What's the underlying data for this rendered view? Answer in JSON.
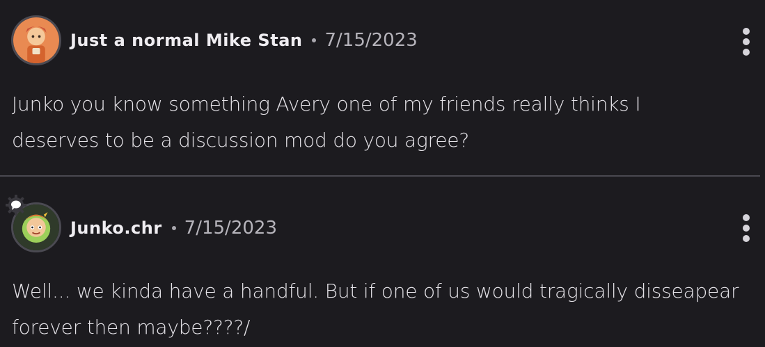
{
  "comments": [
    {
      "username": "Just a normal Mike Stan",
      "separator": "•",
      "date": "7/15/2023",
      "lines": [
        "Junko you know something Avery one of my friends really thinks I",
        "deserves to be a discussion mod do you agree?"
      ],
      "avatar_icon": "cartoon-character-avatar",
      "more_icon": "more-vertical-icon"
    },
    {
      "username": "Junko.chr",
      "separator": "•",
      "date": "7/15/2023",
      "lines": [
        "Well... we kinda have a handful. But if one of us would tragically disseapear",
        "forever then maybe????/"
      ],
      "avatar_icon": "cartoon-character-avatar",
      "badge_icon": "chat-bubble-gear-icon",
      "more_icon": "more-vertical-icon"
    }
  ],
  "colors": {
    "background": "#1c1b1f",
    "divider": "#4a4950",
    "text": "#e4e2e7",
    "muted": "#b6b4bb"
  }
}
